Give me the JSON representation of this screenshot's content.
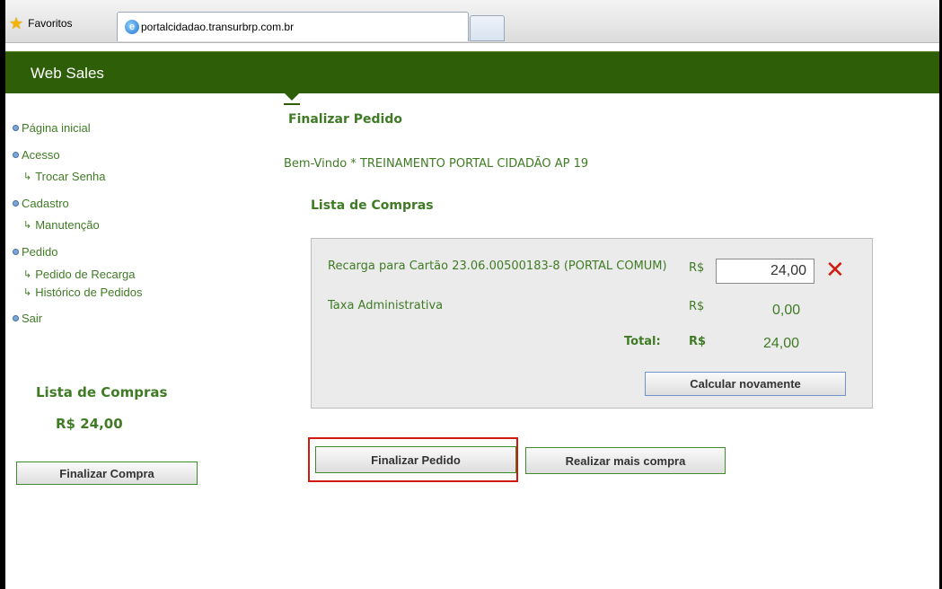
{
  "browser": {
    "favorites_label": "Favoritos",
    "tab_title": "portalcidadao.transurbrp.com.br"
  },
  "header": {
    "title": "Web Sales"
  },
  "sidebar": {
    "items": [
      {
        "label": "Página inicial"
      },
      {
        "label": "Acesso",
        "sub": [
          {
            "label": "Trocar Senha"
          }
        ]
      },
      {
        "label": "Cadastro",
        "sub": [
          {
            "label": "Manutenção"
          }
        ]
      },
      {
        "label": "Pedido",
        "sub": [
          {
            "label": "Pedido de Recarga"
          },
          {
            "label": "Histórico de Pedidos"
          }
        ]
      },
      {
        "label": "Sair"
      }
    ],
    "cart_title": "Lista de Compras",
    "cart_total": "R$ 24,00",
    "finalize_purchase_label": "Finalizar Compra"
  },
  "main": {
    "title": "Finalizar Pedido",
    "welcome": "Bem-Vindo * TREINAMENTO PORTAL CIDADÃO AP 19",
    "list_title": "Lista de Compras",
    "cart": {
      "items": [
        {
          "description": "Recarga para Cartão 23.06.00500183-8 (PORTAL COMUM)",
          "currency": "R$",
          "value": "24,00"
        },
        {
          "description": "Taxa Administrativa",
          "currency": "R$",
          "value": "0,00"
        }
      ],
      "total_label": "Total:",
      "total_currency": "R$",
      "total_value": "24,00",
      "recalculate_label": "Calcular novamente"
    },
    "finalize_order_label": "Finalizar Pedido",
    "more_purchase_label": "Realizar mais compra"
  }
}
